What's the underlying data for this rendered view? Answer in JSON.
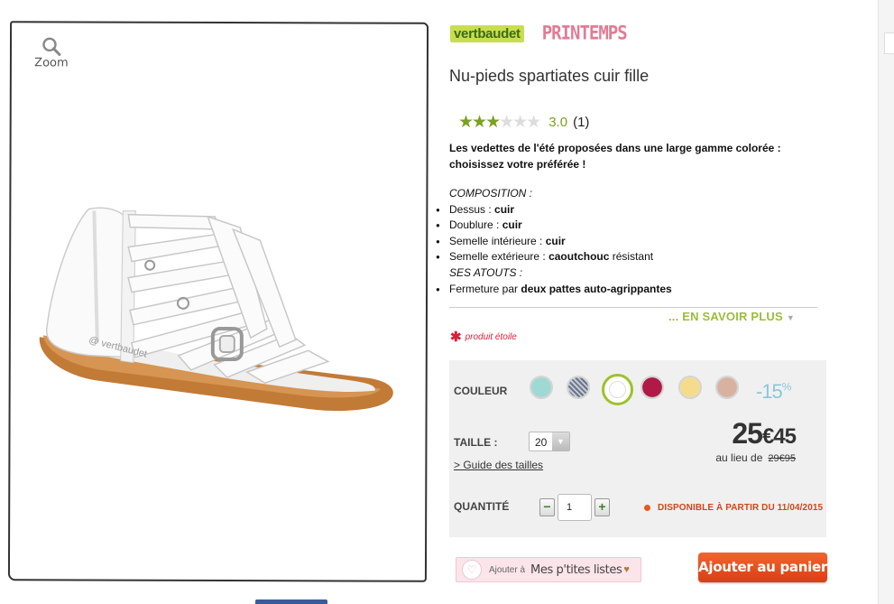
{
  "image": {
    "zoom_label": "Zoom"
  },
  "brands": {
    "primary": "vertbaudet",
    "secondary": "PRINTEMPS"
  },
  "product": {
    "title": "Nu-pieds spartiates cuir fille",
    "rating": {
      "value": "3.0",
      "count": "(1)",
      "stars_filled": 3,
      "stars_total": 6
    },
    "description": "Les vedettes de l'été proposées dans une large gamme colorée : choisissez votre préférée !",
    "composition_heading": "COMPOSITION :",
    "composition": [
      {
        "label": "Dessus : ",
        "value": "cuir",
        "suffix": ""
      },
      {
        "label": "Doublure : ",
        "value": "cuir",
        "suffix": ""
      },
      {
        "label": "Semelle intérieure : ",
        "value": "cuir",
        "suffix": ""
      },
      {
        "label": "Semelle extérieure : ",
        "value": "caoutchouc",
        "suffix": " résistant"
      }
    ],
    "atouts_heading": "SES ATOUTS :",
    "atouts": [
      {
        "label": "Fermeture par ",
        "value": "deux pattes auto-agrippantes"
      }
    ],
    "more_link": "... EN SAVOIR PLUS",
    "star_product": "produit étoile"
  },
  "options": {
    "color_label": "COULEUR",
    "colors": [
      "#9fd9d3",
      "#8b96a8",
      "#ffffff",
      "#b01a47",
      "#f5dc8c",
      "#d8b1a0"
    ],
    "selected_color_index": 2,
    "discount": "-15",
    "discount_unit": "%",
    "size_label": "TAILLE :",
    "size_value": "20",
    "size_guide": "> Guide des tailles",
    "price_main": "25",
    "price_cents": "€45",
    "price_instead": "au lieu de",
    "price_old": "29€95",
    "quantity_label": "QUANTITÉ",
    "quantity_value": "1",
    "minus": "−",
    "plus": "+",
    "availability": "DISPONIBLE À PARTIR DU 11/04/2015"
  },
  "actions": {
    "wishlist_prefix": "Ajouter à",
    "wishlist_name": "Mes p'tites listes",
    "add_to_cart": "Ajouter au panier"
  }
}
